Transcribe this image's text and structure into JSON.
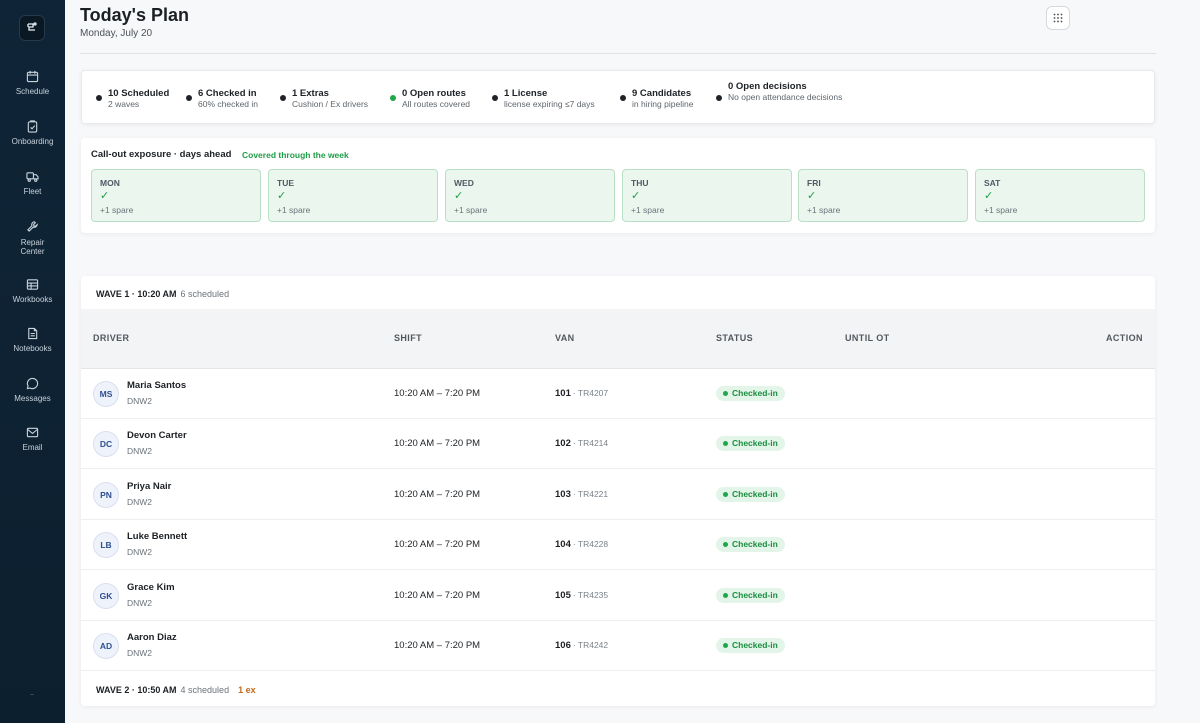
{
  "sidebar": {
    "items": [
      {
        "label": "Schedule",
        "icon": "calendar-icon"
      },
      {
        "label": "Onboarding",
        "icon": "clipboard-check-icon"
      },
      {
        "label": "Fleet",
        "icon": "truck-icon"
      },
      {
        "label": "Repair Center",
        "icon": "wrench-icon"
      },
      {
        "label": "Workbooks",
        "icon": "table-icon"
      },
      {
        "label": "Notebooks",
        "icon": "notebook-icon"
      },
      {
        "label": "Messages",
        "icon": "chat-icon"
      },
      {
        "label": "Email",
        "icon": "mail-icon"
      }
    ]
  },
  "header": {
    "title": "Today's Plan",
    "date": "Monday, July 20"
  },
  "stats": [
    {
      "title": "10 Scheduled",
      "sub": "2 waves",
      "dot": "dark"
    },
    {
      "title": "6 Checked in",
      "sub": "60% checked in",
      "dot": "dark"
    },
    {
      "title": "1 Extras",
      "sub": "Cushion / Ex drivers",
      "dot": "dark"
    },
    {
      "title": "0 Open routes",
      "sub": "All routes covered",
      "dot": "green"
    },
    {
      "title": "1 License",
      "sub": "license expiring ≤7 days",
      "dot": "dark"
    },
    {
      "title": "9 Candidates",
      "sub": "in hiring pipeline",
      "dot": "dark"
    },
    {
      "title": "0 Open decisions",
      "sub": "No open attendance decisions",
      "dot": "dark"
    }
  ],
  "exposure": {
    "title": "Call-out exposure · days ahead",
    "status": "Covered through the week",
    "days": [
      {
        "day": "MON",
        "mark": "✓",
        "spare": "+1 spare"
      },
      {
        "day": "TUE",
        "mark": "✓",
        "spare": "+1 spare"
      },
      {
        "day": "WED",
        "mark": "✓",
        "spare": "+1 spare"
      },
      {
        "day": "THU",
        "mark": "✓",
        "spare": "+1 spare"
      },
      {
        "day": "FRI",
        "mark": "✓",
        "spare": "+1 spare"
      },
      {
        "day": "SAT",
        "mark": "✓",
        "spare": "+1 spare"
      }
    ]
  },
  "table": {
    "columns": [
      "DRIVER",
      "SHIFT",
      "VAN",
      "STATUS",
      "UNTIL OT",
      "ACTION"
    ],
    "waves": [
      {
        "title": "WAVE 1 · 10:20 AM",
        "scheduled": "6 scheduled",
        "extra": ""
      },
      {
        "title": "WAVE 2 · 10:50 AM",
        "scheduled": "4 scheduled",
        "extra": "1 ex"
      }
    ],
    "rows": [
      {
        "initials": "MS",
        "name": "Maria Santos",
        "station": "DNW2",
        "shift": "10:20 AM – 7:20 PM",
        "van": "101",
        "plate": "· TR4207",
        "status": "Checked-in"
      },
      {
        "initials": "DC",
        "name": "Devon Carter",
        "station": "DNW2",
        "shift": "10:20 AM – 7:20 PM",
        "van": "102",
        "plate": "· TR4214",
        "status": "Checked-in"
      },
      {
        "initials": "PN",
        "name": "Priya Nair",
        "station": "DNW2",
        "shift": "10:20 AM – 7:20 PM",
        "van": "103",
        "plate": "· TR4221",
        "status": "Checked-in"
      },
      {
        "initials": "LB",
        "name": "Luke Bennett",
        "station": "DNW2",
        "shift": "10:20 AM – 7:20 PM",
        "van": "104",
        "plate": "· TR4228",
        "status": "Checked-in"
      },
      {
        "initials": "GK",
        "name": "Grace Kim",
        "station": "DNW2",
        "shift": "10:20 AM – 7:20 PM",
        "van": "105",
        "plate": "· TR4235",
        "status": "Checked-in"
      },
      {
        "initials": "AD",
        "name": "Aaron Diaz",
        "station": "DNW2",
        "shift": "10:20 AM – 7:20 PM",
        "van": "106",
        "plate": "· TR4242",
        "status": "Checked-in"
      }
    ]
  },
  "colors": {
    "sidebar": "#0f2537",
    "accent_green": "#1f9d46",
    "extra_orange": "#c06a1a"
  }
}
